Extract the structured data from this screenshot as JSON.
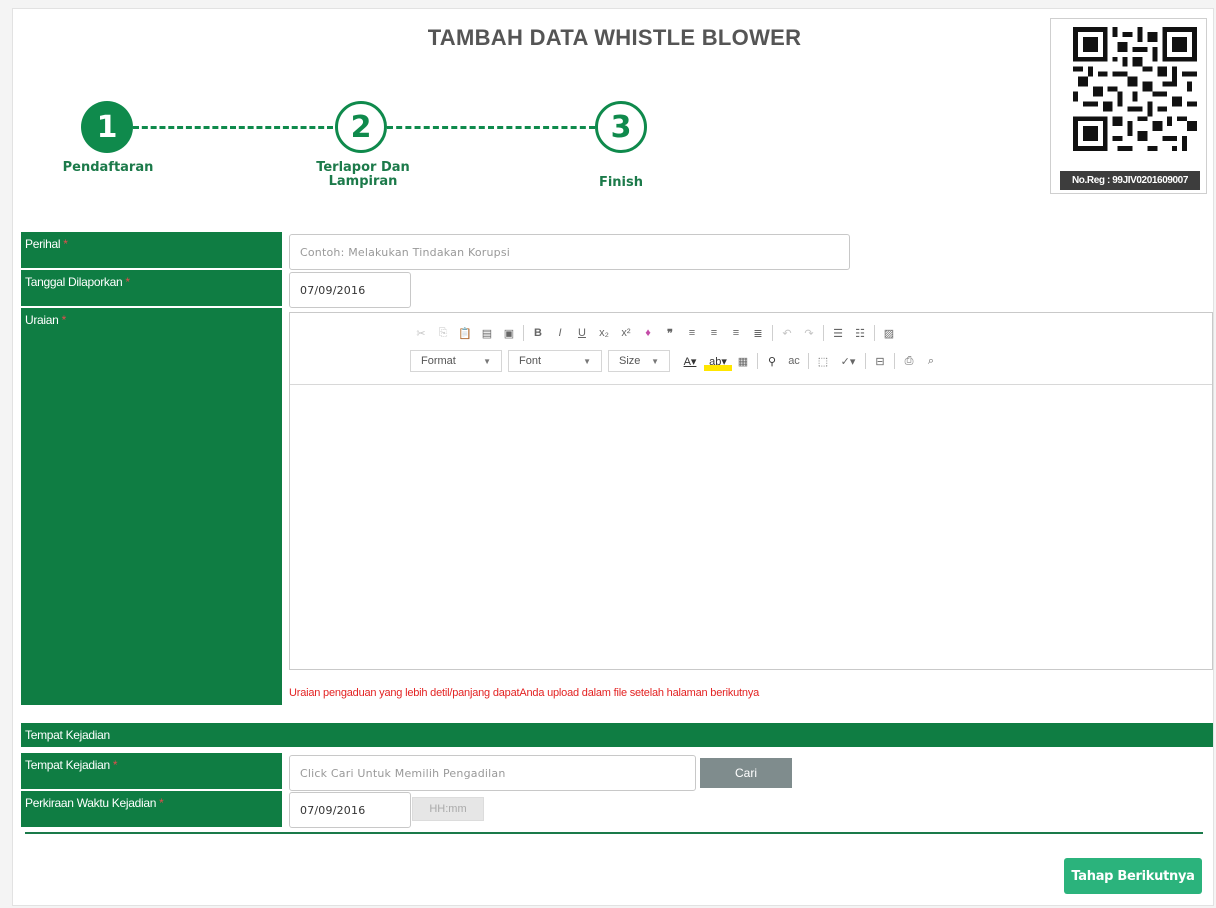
{
  "page": {
    "title": "TAMBAH DATA WHISTLE BLOWER"
  },
  "steps": [
    {
      "number": "1",
      "label": "Pendaftaran",
      "state": "active"
    },
    {
      "number": "2",
      "label": "Terlapor Dan\nLampiran",
      "state": "inactive"
    },
    {
      "number": "3",
      "label": "Finish",
      "state": "inactive"
    }
  ],
  "qr": {
    "reg_label": "No.Reg : 99JIV0201609007",
    "icon": "qr-code"
  },
  "form": {
    "perihal_label": "Perihal",
    "perihal_placeholder": "Contoh: Melakukan Tindakan Korupsi",
    "tanggal_label": "Tanggal Dilaporkan",
    "tanggal_value": "07/09/2016",
    "uraian_label": "Uraian",
    "required_mark": "*",
    "uraian_hint": "Uraian pengaduan yang lebih detil/panjang dapatAnda upload dalam file setelah halaman berikutnya"
  },
  "editor": {
    "format_label": "Format",
    "font_label": "Font",
    "size_label": "Size",
    "toolbar_icons_row1": [
      "cut-icon",
      "copy-icon",
      "paste-icon",
      "paste-text-icon",
      "paste-word-icon",
      "bold-icon",
      "italic-icon",
      "underline-icon",
      "subscript-icon",
      "superscript-icon",
      "remove-format-icon",
      "blockquote-icon",
      "align-left-icon",
      "align-center-icon",
      "align-right-icon",
      "justify-icon",
      "undo-icon",
      "redo-icon",
      "numbered-list-icon",
      "bulleted-list-icon",
      "image-icon"
    ],
    "toolbar_glyphs": {
      "bold": "B",
      "italic": "I",
      "underline": "U",
      "subscript": "x₂",
      "superscript": "x²",
      "blockquote": "❞"
    }
  },
  "section": {
    "title": "Tempat Kejadian",
    "tempat_label": "Tempat Kejadian",
    "tempat_placeholder": "Click Cari Untuk Memilih Pengadilan",
    "cari_label": "Cari",
    "waktu_label": "Perkiraan Waktu Kejadian",
    "waktu_date": "07/09/2016",
    "waktu_time_placeholder": "HH:mm"
  },
  "actions": {
    "next_label": "Tahap Berikutnya"
  },
  "colors": {
    "primary_green": "#0f7d43",
    "step_green": "#0f8a4c",
    "next_button": "#2bb37c",
    "cari_button": "#7f8c8d",
    "required": "#e34c4c",
    "hint_red": "#e32222"
  }
}
